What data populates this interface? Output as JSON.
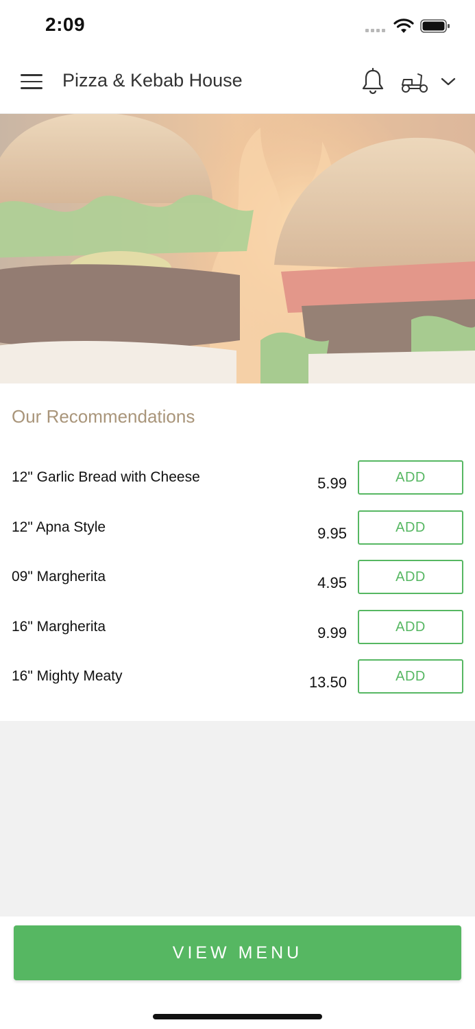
{
  "status_bar": {
    "time": "2:09"
  },
  "header": {
    "title": "Pizza & Kebab House"
  },
  "recommendations": {
    "title": "Our Recommendations",
    "items": [
      {
        "name": "12\" Garlic Bread with Cheese",
        "price": "5.99",
        "button": "ADD"
      },
      {
        "name": "12\" Apna Style",
        "price": "9.95",
        "button": "ADD"
      },
      {
        "name": "09\" Margherita",
        "price": "4.95",
        "button": "ADD"
      },
      {
        "name": "16\" Margherita",
        "price": "9.99",
        "button": "ADD"
      },
      {
        "name": "16\" Mighty Meaty",
        "price": "13.50",
        "button": "ADD"
      }
    ]
  },
  "footer": {
    "view_menu_label": "VIEW MENU"
  },
  "colors": {
    "accent": "#56b762",
    "section_title": "#a9957a"
  },
  "icons": [
    "menu-icon",
    "bell-icon",
    "scooter-icon",
    "chevron-down-icon",
    "wifi-icon",
    "battery-icon"
  ]
}
